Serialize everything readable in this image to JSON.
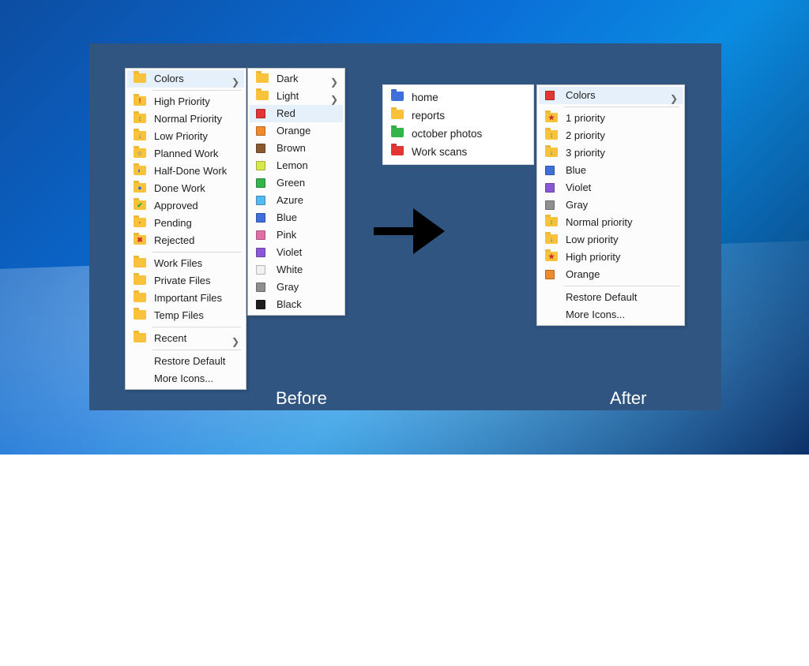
{
  "labels": {
    "before": "Before",
    "after": "After"
  },
  "colors": {
    "yellowFolder": "#f8c23a",
    "red": "#e43535",
    "orange": "#f08a2d",
    "brown": "#8a5a2e",
    "lemon": "#d8e84a",
    "green": "#35b44a",
    "azure": "#55b9f2",
    "blue": "#3f6fd8",
    "pink": "#e06fa8",
    "violet": "#8a58d6",
    "white": "#f2f2f2",
    "gray": "#8f8f8f",
    "black": "#1d1d1d"
  },
  "before": {
    "main": [
      {
        "label": "Colors",
        "folder": "yellowFolder",
        "expand": true,
        "hover": true
      },
      "sep",
      {
        "label": "High Priority",
        "folder": "yellowFolder",
        "mark": "!",
        "markColor": "#d02a2a"
      },
      {
        "label": "Normal Priority",
        "folder": "yellowFolder",
        "mark": "↕",
        "markColor": "#2f9e44"
      },
      {
        "label": "Low Priority",
        "folder": "yellowFolder",
        "mark": "↓",
        "markColor": "#2e6fd8"
      },
      {
        "label": "Planned Work",
        "folder": "yellowFolder",
        "mark": "○",
        "markColor": "#2e6fd8"
      },
      {
        "label": "Half-Done Work",
        "folder": "yellowFolder",
        "mark": "◐",
        "markColor": "#2e6fd8"
      },
      {
        "label": "Done Work",
        "folder": "yellowFolder",
        "mark": "●",
        "markColor": "#2e6fd8"
      },
      {
        "label": "Approved",
        "folder": "yellowFolder",
        "mark": "✔",
        "markColor": "#2f9e44"
      },
      {
        "label": "Pending",
        "folder": "yellowFolder",
        "mark": "•",
        "markColor": "#d58a2a"
      },
      {
        "label": "Rejected",
        "folder": "yellowFolder",
        "mark": "✖",
        "markColor": "#d02a2a"
      },
      "sep",
      {
        "label": "Work Files",
        "folder": "yellowFolder"
      },
      {
        "label": "Private Files",
        "folder": "yellowFolder"
      },
      {
        "label": "Important Files",
        "folder": "yellowFolder"
      },
      {
        "label": "Temp Files",
        "folder": "yellowFolder"
      },
      "sep",
      {
        "label": "Recent",
        "folder": "yellowFolder",
        "expand": true
      },
      "sep",
      {
        "label": "Restore Default"
      },
      {
        "label": "More Icons..."
      }
    ],
    "submenu": [
      {
        "label": "Dark",
        "folder": "yellowFolder",
        "expand": true
      },
      {
        "label": "Light",
        "folder": "yellowFolder",
        "expand": true
      },
      {
        "label": "Red",
        "swatch": "red",
        "hover": true
      },
      {
        "label": "Orange",
        "swatch": "orange"
      },
      {
        "label": "Brown",
        "swatch": "brown"
      },
      {
        "label": "Lemon",
        "swatch": "lemon"
      },
      {
        "label": "Green",
        "swatch": "green"
      },
      {
        "label": "Azure",
        "swatch": "azure"
      },
      {
        "label": "Blue",
        "swatch": "blue"
      },
      {
        "label": "Pink",
        "swatch": "pink"
      },
      {
        "label": "Violet",
        "swatch": "violet"
      },
      {
        "label": "White",
        "swatch": "white"
      },
      {
        "label": "Gray",
        "swatch": "gray"
      },
      {
        "label": "Black",
        "swatch": "black"
      }
    ]
  },
  "after": {
    "folders": [
      {
        "label": "home",
        "color": "blue"
      },
      {
        "label": "reports",
        "color": "yellowFolder"
      },
      {
        "label": "october photos",
        "color": "green"
      },
      {
        "label": "Work scans",
        "color": "red"
      }
    ],
    "menu": [
      {
        "label": "Colors",
        "swatch": "red",
        "expand": true,
        "hover": true
      },
      "sep",
      {
        "label": "1 priority",
        "folder": "yellowFolder",
        "mark": "★",
        "markColor": "#d02a2a"
      },
      {
        "label": "2 priority",
        "folder": "yellowFolder",
        "mark": "↕",
        "markColor": "#2f9e44"
      },
      {
        "label": "3 priority",
        "folder": "yellowFolder",
        "mark": "↓",
        "markColor": "#2e6fd8"
      },
      {
        "label": "Blue",
        "swatch": "blue"
      },
      {
        "label": "Violet",
        "swatch": "violet"
      },
      {
        "label": "Gray",
        "swatch": "gray"
      },
      {
        "label": "Normal priority",
        "folder": "yellowFolder",
        "mark": "↕",
        "markColor": "#2f9e44"
      },
      {
        "label": "Low priority",
        "folder": "yellowFolder",
        "mark": "↓",
        "markColor": "#2e6fd8"
      },
      {
        "label": "High priority",
        "folder": "yellowFolder",
        "mark": "★",
        "markColor": "#d02a2a"
      },
      {
        "label": "Orange",
        "swatch": "orange"
      },
      "sep",
      {
        "label": "Restore Default"
      },
      {
        "label": "More Icons..."
      }
    ]
  }
}
